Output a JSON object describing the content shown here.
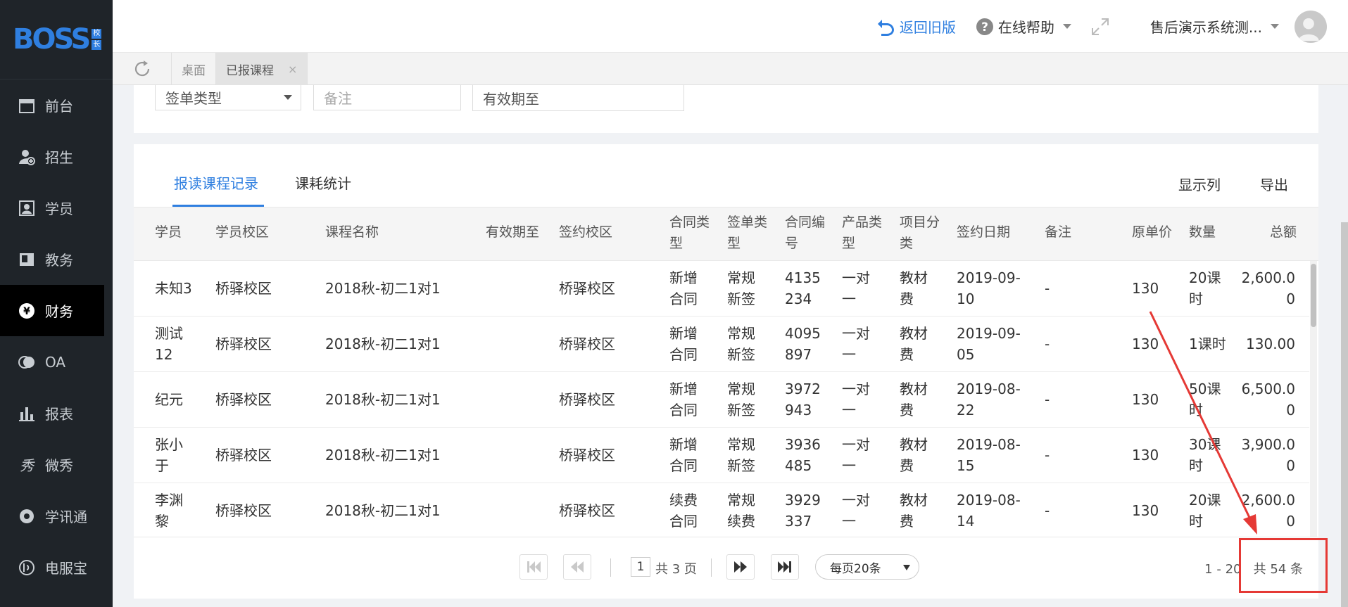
{
  "logo": {
    "text": "BOSS",
    "badge": [
      "校",
      "长"
    ]
  },
  "sidebar": {
    "items": [
      {
        "label": "前台",
        "icon": "calendar-icon"
      },
      {
        "label": "招生",
        "icon": "add-user-icon"
      },
      {
        "label": "学员",
        "icon": "student-card-icon"
      },
      {
        "label": "教务",
        "icon": "book-icon"
      },
      {
        "label": "财务",
        "icon": "yen-icon",
        "active": true
      },
      {
        "label": "OA",
        "icon": "oa-icon"
      },
      {
        "label": "报表",
        "icon": "bar-chart-icon"
      },
      {
        "label": "微秀",
        "icon": "weixiu-icon"
      },
      {
        "label": "学讯通",
        "icon": "location-icon"
      },
      {
        "label": "电服宝",
        "icon": "phone-service-icon"
      }
    ]
  },
  "header": {
    "back_old": "返回旧版",
    "help": "在线帮助",
    "user": "售后演示系统测..."
  },
  "page_tabs": [
    {
      "label": "桌面"
    },
    {
      "label": "已报课程",
      "close": "×"
    }
  ],
  "filters": {
    "sign_type": "签单类型",
    "remark_placeholder": "备注",
    "valid_until": "有效期至"
  },
  "content_tabs": [
    "报读课程记录",
    "课耗统计"
  ],
  "actions": {
    "columns": "显示列",
    "export": "导出"
  },
  "table": {
    "headers": {
      "student": "学员",
      "student_campus": "学员校区",
      "course_name": "课程名称",
      "valid_until": "有效期至",
      "sign_campus": "签约校区",
      "contract_type": [
        "合同类",
        "型"
      ],
      "sign_type": [
        "签单类",
        "型"
      ],
      "contract_no": [
        "合同编",
        "号"
      ],
      "product_type": [
        "产品类",
        "型"
      ],
      "item_category": [
        "项目分",
        "类"
      ],
      "sign_date": "签约日期",
      "remark": "备注",
      "unit_price": "原单价",
      "quantity": "数量",
      "total": "总额"
    },
    "rows": [
      {
        "student": [
          "未知3"
        ],
        "student_campus": "桥驿校区",
        "course": "2018秋-初二1对1",
        "valid": "",
        "sign_campus": "桥驿校区",
        "contract_type": [
          "新增",
          "合同"
        ],
        "sign_type": [
          "常规",
          "新签"
        ],
        "contract_no": [
          "4135",
          "234"
        ],
        "product_type": [
          "一对",
          "一"
        ],
        "item_category": [
          "教材",
          "费"
        ],
        "date": [
          "2019-09-",
          "10"
        ],
        "remark": "-",
        "price": "130",
        "qty": [
          "20课",
          "时"
        ],
        "total": [
          "2,600.0",
          "0"
        ]
      },
      {
        "student": [
          "测试",
          "12"
        ],
        "student_campus": "桥驿校区",
        "course": "2018秋-初二1对1",
        "valid": "",
        "sign_campus": "桥驿校区",
        "contract_type": [
          "新增",
          "合同"
        ],
        "sign_type": [
          "常规",
          "新签"
        ],
        "contract_no": [
          "4095",
          "897"
        ],
        "product_type": [
          "一对",
          "一"
        ],
        "item_category": [
          "教材",
          "费"
        ],
        "date": [
          "2019-09-",
          "05"
        ],
        "remark": "-",
        "price": "130",
        "qty": [
          "1课时"
        ],
        "total": [
          "130.00"
        ]
      },
      {
        "student": [
          "纪元"
        ],
        "student_campus": "桥驿校区",
        "course": "2018秋-初二1对1",
        "valid": "",
        "sign_campus": "桥驿校区",
        "contract_type": [
          "新增",
          "合同"
        ],
        "sign_type": [
          "常规",
          "新签"
        ],
        "contract_no": [
          "3972",
          "943"
        ],
        "product_type": [
          "一对",
          "一"
        ],
        "item_category": [
          "教材",
          "费"
        ],
        "date": [
          "2019-08-",
          "22"
        ],
        "remark": "-",
        "price": "130",
        "qty": [
          "50课",
          "时"
        ],
        "total": [
          "6,500.0",
          "0"
        ]
      },
      {
        "student": [
          "张小",
          "于"
        ],
        "student_campus": "桥驿校区",
        "course": "2018秋-初二1对1",
        "valid": "",
        "sign_campus": "桥驿校区",
        "contract_type": [
          "新增",
          "合同"
        ],
        "sign_type": [
          "常规",
          "新签"
        ],
        "contract_no": [
          "3936",
          "485"
        ],
        "product_type": [
          "一对",
          "一"
        ],
        "item_category": [
          "教材",
          "费"
        ],
        "date": [
          "2019-08-",
          "15"
        ],
        "remark": "-",
        "price": "130",
        "qty": [
          "30课",
          "时"
        ],
        "total": [
          "3,900.0",
          "0"
        ]
      },
      {
        "student": [
          "李渊",
          "黎"
        ],
        "student_campus": "桥驿校区",
        "course": "2018秋-初二1对1",
        "valid": "",
        "sign_campus": "桥驿校区",
        "contract_type": [
          "续费",
          "合同"
        ],
        "sign_type": [
          "常规",
          "续费"
        ],
        "contract_no": [
          "3929",
          "337"
        ],
        "product_type": [
          "一对",
          "一"
        ],
        "item_category": [
          "教材",
          "费"
        ],
        "date": [
          "2019-08-",
          "14"
        ],
        "remark": "-",
        "price": "130",
        "qty": [
          "20课",
          "时"
        ],
        "total": [
          "2,600.0",
          "0"
        ]
      }
    ]
  },
  "pagination": {
    "current_page": "1",
    "total_pages": "共 3 页",
    "page_size": "每页20条",
    "range": "1 - 20",
    "total": "共 54 条"
  },
  "colors": {
    "accent": "#2f7fe0",
    "sidebar_bg": "#1f2429",
    "annotation": "#e53935"
  }
}
